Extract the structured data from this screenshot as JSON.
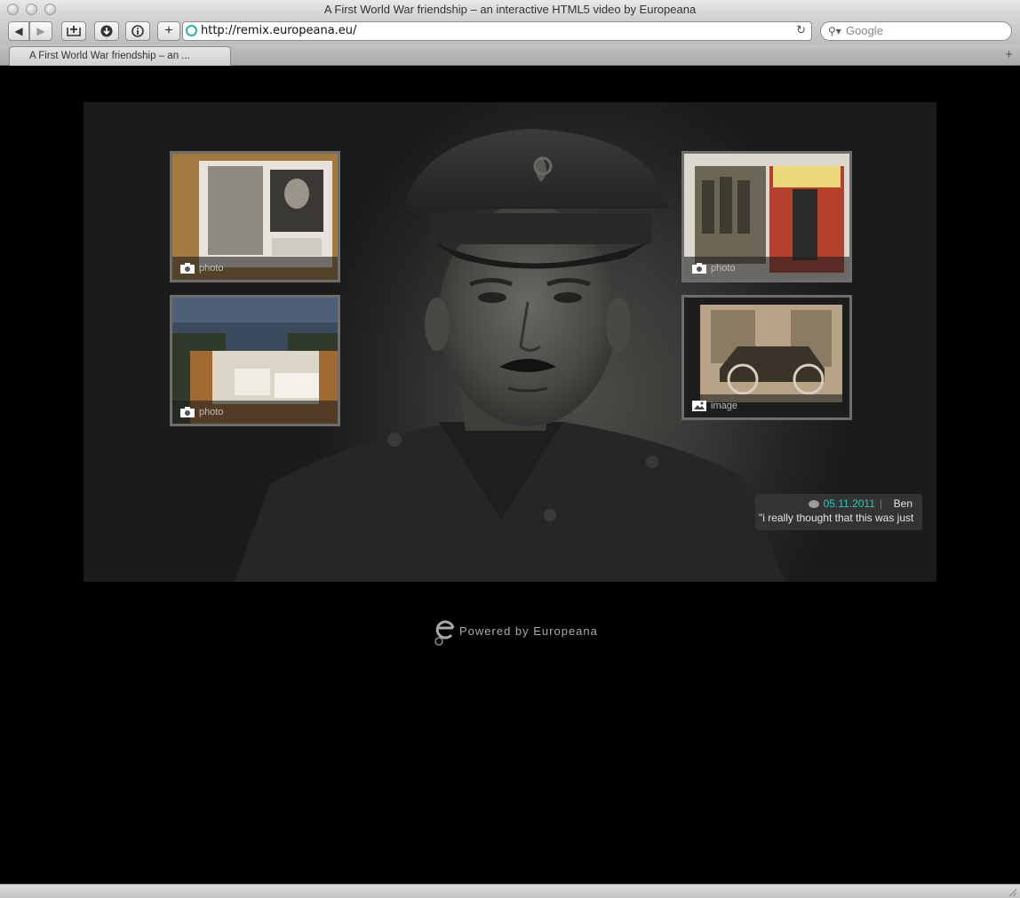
{
  "window": {
    "title": "A First World War friendship – an interactive HTML5 video by Europeana"
  },
  "toolbar": {
    "back_icon": "back-arrow-icon",
    "forward_icon": "forward-arrow-icon",
    "url": "http://remix.europeana.eu/",
    "search_placeholder": "Google"
  },
  "tabs": [
    {
      "label": "A First World War friendship – an ..."
    }
  ],
  "video": {
    "thumbnails": [
      {
        "type_label": "photo",
        "icon": "camera-icon"
      },
      {
        "type_label": "photo",
        "icon": "camera-icon"
      },
      {
        "type_label": "photo",
        "icon": "camera-icon"
      },
      {
        "type_label": "image",
        "icon": "image-icon"
      }
    ],
    "comment": {
      "date": "05.11.2011",
      "author": "Ben",
      "text": "\"i really thought that this was just"
    }
  },
  "footer": {
    "powered_by": "Powered by Europeana"
  },
  "colors": {
    "accent": "#31c6b6",
    "background": "#000000"
  }
}
